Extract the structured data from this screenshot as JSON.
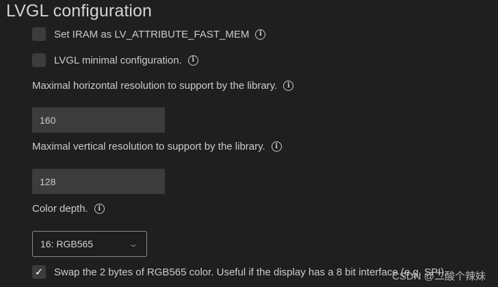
{
  "title": "LVGL configuration",
  "options": {
    "iram": {
      "label": "Set IRAM as LV_ATTRIBUTE_FAST_MEM",
      "checked": false
    },
    "minimal": {
      "label": "LVGL minimal configuration.",
      "checked": false
    },
    "swap": {
      "label": "Swap the 2 bytes of RGB565 color. Useful if the display has a 8 bit interface (e.g. SPI).",
      "checked": true,
      "check_glyph": "✓"
    }
  },
  "hres": {
    "label": "Maximal horizontal resolution to support by the library.",
    "value": "160"
  },
  "vres": {
    "label": "Maximal vertical resolution to support by the library.",
    "value": "128"
  },
  "color_depth": {
    "label": "Color depth.",
    "value": "16: RGB565"
  },
  "info_glyph": "i",
  "watermark": "CSDN @二酸个辣妹",
  "colors": {
    "background": "#1f1f1f",
    "input_bg": "#3c3c3c",
    "chevron": "#6c7ee8"
  }
}
